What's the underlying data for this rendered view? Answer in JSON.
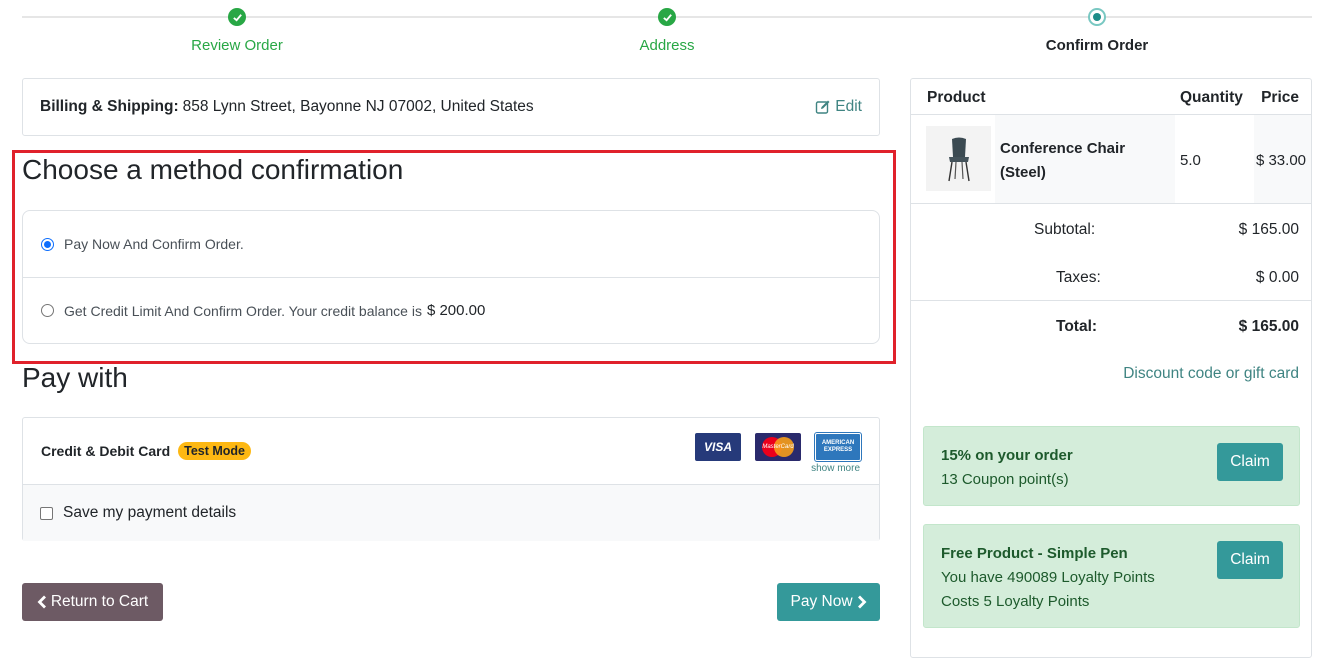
{
  "stepper": {
    "steps": [
      {
        "label": "Review Order",
        "state": "done"
      },
      {
        "label": "Address",
        "state": "done"
      },
      {
        "label": "Confirm Order",
        "state": "current"
      }
    ]
  },
  "billing": {
    "label": "Billing & Shipping:",
    "address": "858 Lynn Street, Bayonne NJ 07002, United States",
    "edit_label": "Edit"
  },
  "method": {
    "title": "Choose a method confirmation",
    "options": [
      {
        "label": "Pay Now And Confirm Order.",
        "selected": true
      },
      {
        "label": "Get Credit Limit And Confirm Order. Your credit balance is",
        "amount": "$ 200.00",
        "selected": false
      }
    ]
  },
  "pay": {
    "title": "Pay with",
    "provider_name": "Credit & Debit Card",
    "badge": "Test Mode",
    "cards": [
      "VISA",
      "MasterCard",
      "AMERICAN EXPRESS"
    ],
    "show_more": "show more",
    "save_label": "Save my payment details"
  },
  "buttons": {
    "back_label": "Return to Cart",
    "pay_label": "Pay Now"
  },
  "summary": {
    "headers": {
      "product": "Product",
      "quantity": "Quantity",
      "price": "Price"
    },
    "product": {
      "name": "Conference Chair (Steel)",
      "quantity": "5.0",
      "price": "$ 33.00"
    },
    "subtotal_label": "Subtotal:",
    "subtotal": "$ 165.00",
    "taxes_label": "Taxes:",
    "taxes": "$ 0.00",
    "total_label": "Total:",
    "total": "$ 165.00",
    "discount_link": "Discount code or gift card"
  },
  "promos": [
    {
      "title": "15% on your order",
      "lines": [
        "13 Coupon point(s)"
      ],
      "button": "Claim"
    },
    {
      "title": "Free Product - Simple Pen",
      "lines": [
        "You have 490089 Loyalty Points",
        "Costs 5 Loyalty Points"
      ],
      "button": "Claim"
    }
  ],
  "colors": {
    "accent": "#34999a",
    "success": "#28a745",
    "highlight": "#e0212b",
    "promo_bg": "#d4edda"
  }
}
